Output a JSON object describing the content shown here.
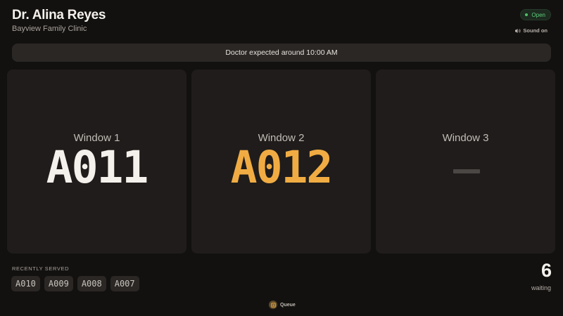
{
  "header": {
    "title": "Dr. Alina Reyes",
    "subtitle": "Bayview Family Clinic",
    "status": "Open",
    "sound_label": "Sound on"
  },
  "announcement": "Doctor expected around 10:00 AM",
  "windows": [
    {
      "label": "Window 1",
      "ticket": "A011",
      "state": "serving"
    },
    {
      "label": "Window 2",
      "ticket": "A012",
      "state": "called"
    },
    {
      "label": "Window 3",
      "ticket": "",
      "state": "idle"
    }
  ],
  "recent": {
    "label": "RECENTLY SERVED",
    "tickets": [
      "A010",
      "A009",
      "A008",
      "A007"
    ]
  },
  "waiting": {
    "count": "6",
    "label": "waiting"
  },
  "footer": {
    "queue_label": "Queue"
  },
  "colors": {
    "background": "#131110",
    "card": "#1f1c1b",
    "accent": "#f0ac43",
    "status_green": "#4cc26a"
  },
  "icons": {
    "status": "status-dot-icon",
    "sound": "speaker-icon",
    "queue": "queue-icon"
  }
}
